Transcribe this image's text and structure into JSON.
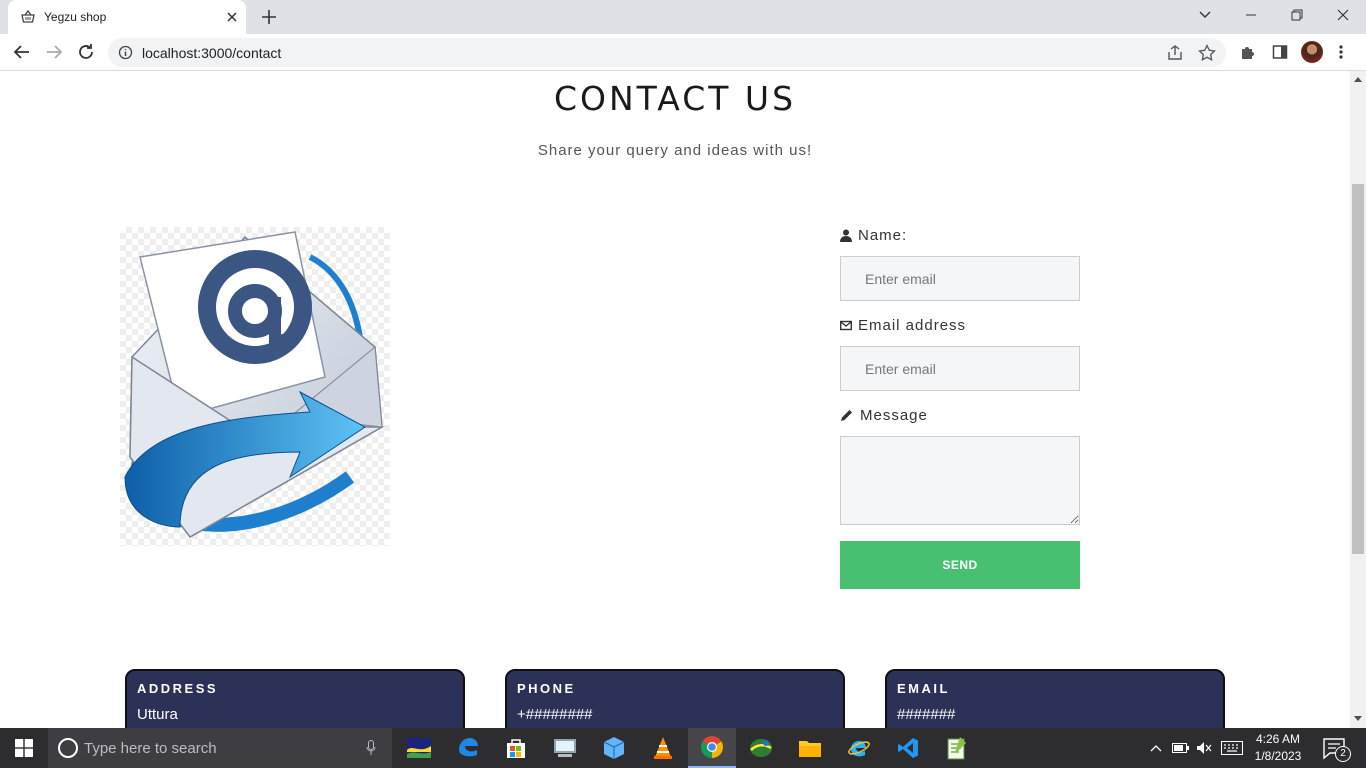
{
  "browser": {
    "tab_title": "Yegzu shop",
    "url": "localhost:3000/contact"
  },
  "page": {
    "title": "CONTACT US",
    "subtitle": "Share your query and ideas with us!"
  },
  "form": {
    "name_label": "Name:",
    "name_placeholder": "Enter email",
    "email_label": "Email address",
    "email_placeholder": "Enter email",
    "message_label": "Message",
    "send_label": "SEND"
  },
  "cards": [
    {
      "title": "ADDRESS",
      "value": "Uttura"
    },
    {
      "title": "PHONE",
      "value": "+########"
    },
    {
      "title": "EMAIL",
      "value": "#######"
    }
  ],
  "taskbar": {
    "search_placeholder": "Type here to search",
    "time": "4:26 AM",
    "date": "1/8/2023",
    "notification_count": "2"
  },
  "colors": {
    "send_button": "#48c072",
    "card_background": "#2c3157"
  }
}
